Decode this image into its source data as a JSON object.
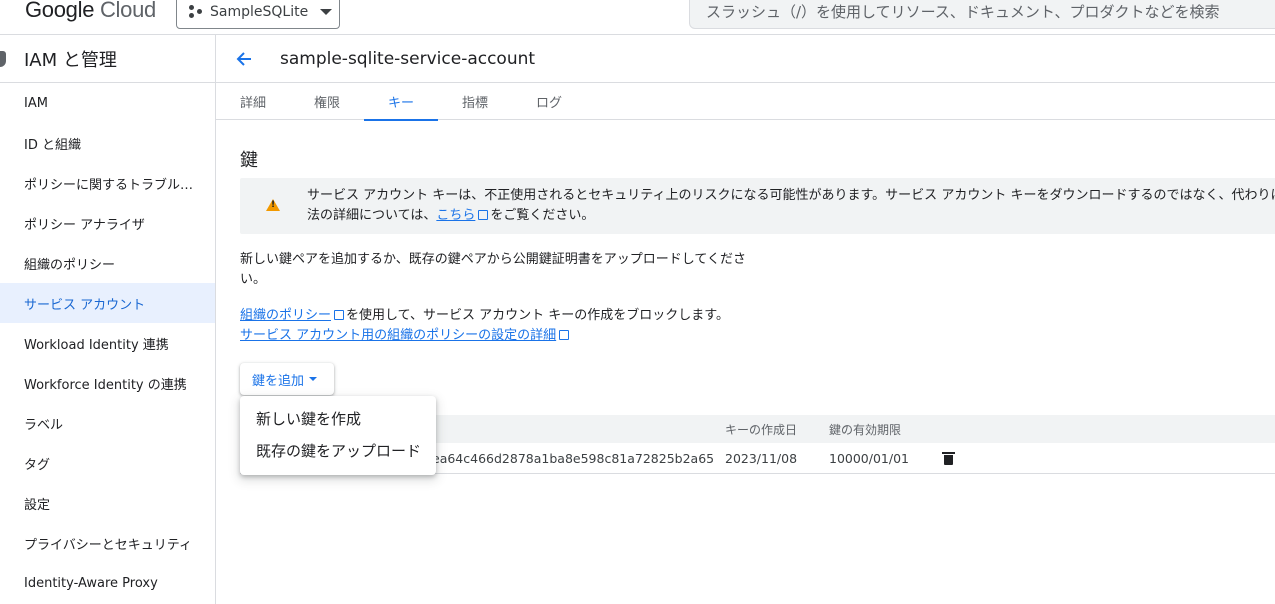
{
  "topbar": {
    "logo": {
      "google": "Google",
      "cloud": "Cloud"
    },
    "project": "SampleSQLite",
    "search_placeholder": "スラッシュ（/）を使用してリソース、ドキュメント、プロダクトなどを検索"
  },
  "sidebar": {
    "title": "IAM と管理",
    "items": [
      {
        "label": "IAM"
      },
      {
        "label": "ID と組織"
      },
      {
        "label": "ポリシーに関するトラブル…"
      },
      {
        "label": "ポリシー アナライザ"
      },
      {
        "label": "組織のポリシー"
      },
      {
        "label": "サービス アカウント"
      },
      {
        "label": "Workload Identity 連携"
      },
      {
        "label": "Workforce Identity の連携"
      },
      {
        "label": "ラベル"
      },
      {
        "label": "タグ"
      },
      {
        "label": "設定"
      },
      {
        "label": "プライバシーとセキュリティ"
      },
      {
        "label": "Identity-Aware Proxy"
      }
    ],
    "active_index": 5
  },
  "page": {
    "title": "sample-sqlite-service-account",
    "tabs": [
      "詳細",
      "権限",
      "キー",
      "指標",
      "ログ"
    ],
    "active_tab": 2
  },
  "keys": {
    "heading": "鍵",
    "warning_line1": "サービス アカウント キーは、不正使用されるとセキュリティ上のリスクになる可能性があります。サービス アカウント キーをダウンロードするのではなく、代わりに",
    "warning_line2_prefix": "法の詳細については、",
    "warning_link": "こちら",
    "warning_line2_suffix": "をご覧ください。",
    "desc_line1": "新しい鍵ペアを追加するか、既存の鍵ペアから公開鍵証明書をアップロードしてくださ",
    "desc_line2": "い。",
    "policy_link": "組織のポリシー",
    "policy_text": "を使用して、サービス アカウント キーの作成をブロックします。",
    "policy_detail_link": "サービス アカウント用の組織のポリシーの設定の詳細",
    "add_key_button": "鍵を追加",
    "menu": [
      "新しい鍵を作成",
      "既存の鍵をアップロード"
    ],
    "table": {
      "headers": {
        "created": "キーの作成日",
        "expires": "鍵の有効期限"
      },
      "rows": [
        {
          "key_id": "ea64c466d2878a1ba8e598c81a72825b2a65",
          "created": "2023/11/08",
          "expires": "10000/01/01"
        }
      ]
    }
  },
  "colors": {
    "accent": "#1a73e8",
    "active_nav_bg": "#e8f0fe",
    "warning": "#f29900"
  }
}
